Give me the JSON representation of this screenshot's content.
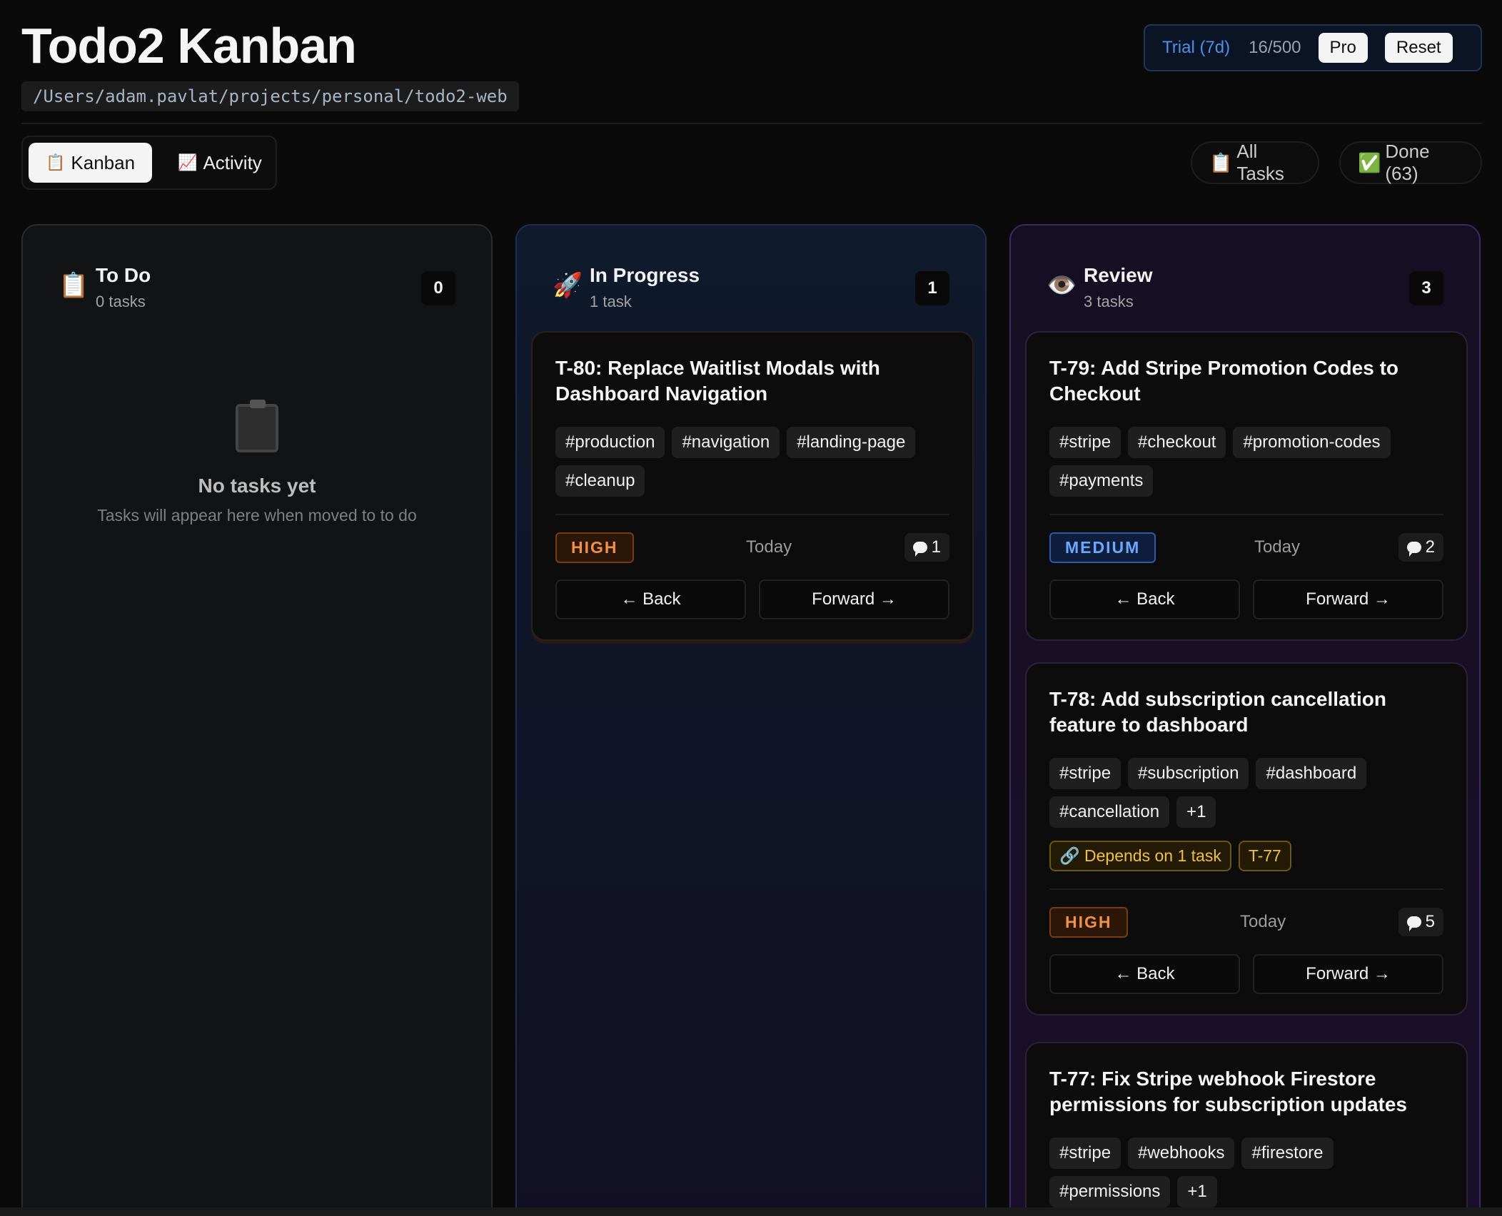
{
  "header": {
    "title": "Todo2 Kanban",
    "path": "/Users/adam.pavlat/projects/personal/todo2-web",
    "trial_label": "Trial (7d)",
    "usage": "16/500",
    "pro_label": "Pro",
    "reset_label": "Reset"
  },
  "tabs": [
    {
      "icon": "📋",
      "label": "Kanban"
    },
    {
      "icon": "📈",
      "label": "Activity"
    }
  ],
  "filters": {
    "all_icon": "📋",
    "all_label": "All Tasks",
    "done_icon": "✅",
    "done_label": "Done (63)"
  },
  "columns": {
    "todo": {
      "icon": "📋",
      "name": "To Do",
      "sub": "0 tasks",
      "count": "0",
      "empty_title": "No tasks yet",
      "empty_sub": "Tasks will appear here when moved to to do"
    },
    "progress": {
      "icon": "🚀",
      "name": "In Progress",
      "sub": "1 task",
      "count": "1"
    },
    "review": {
      "icon": "👁️",
      "name": "Review",
      "sub": "3 tasks",
      "count": "3"
    }
  },
  "cards": {
    "t80": {
      "id": "T-80:",
      "title": "Replace Waitlist Modals with Dashboard Navigation",
      "tags": [
        "#production",
        "#navigation",
        "#landing-page",
        "#cleanup"
      ],
      "priority": "HIGH",
      "date": "Today",
      "comments": "1",
      "back": "← Back",
      "forward": "Forward →"
    },
    "t79": {
      "id": "T-79:",
      "title": "Add Stripe Promotion Codes to Checkout",
      "tags": [
        "#stripe",
        "#checkout",
        "#promotion-codes",
        "#payments"
      ],
      "priority": "MEDIUM",
      "date": "Today",
      "comments": "2",
      "back": "← Back",
      "forward": "Forward →"
    },
    "t78": {
      "id": "T-78:",
      "title": "Add subscription cancellation feature to dashboard",
      "tags": [
        "#stripe",
        "#subscription",
        "#dashboard",
        "#cancellation",
        "+1"
      ],
      "depends": "🔗 Depends on 1 task",
      "dep_id": "T-77",
      "priority": "HIGH",
      "date": "Today",
      "comments": "5",
      "back": "← Back",
      "forward": "Forward →"
    },
    "t77": {
      "id": "T-77:",
      "title": "Fix Stripe webhook Firestore permissions for subscription updates",
      "tags": [
        "#stripe",
        "#webhooks",
        "#firestore",
        "#permissions",
        "+1"
      ]
    }
  },
  "colors": {
    "accent": "#4f8fe8",
    "high": "#f0904a",
    "medium": "#6aa8ff",
    "dependency": "#f0c23a"
  }
}
